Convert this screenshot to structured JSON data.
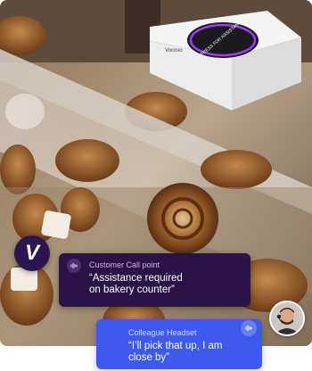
{
  "device": {
    "button_text": "PRESS FOR ASSISTANCE",
    "brand": "Vocovo"
  },
  "badge": {
    "letter": "V"
  },
  "customer_card": {
    "label": "Customer Call point",
    "message_line1": "“Assistance required",
    "message_line2": "on bakery counter”",
    "icon": "sound-wave-icon"
  },
  "colleague_card": {
    "label": "Colleague Headset",
    "message_line1": "“I’ll pick that up, I am",
    "message_line2": "close by”",
    "icon": "sound-wave-icon"
  },
  "colors": {
    "customer_card": "#2a1447",
    "colleague_card": "#3d59ee",
    "device_ring": "#a13cf0"
  }
}
